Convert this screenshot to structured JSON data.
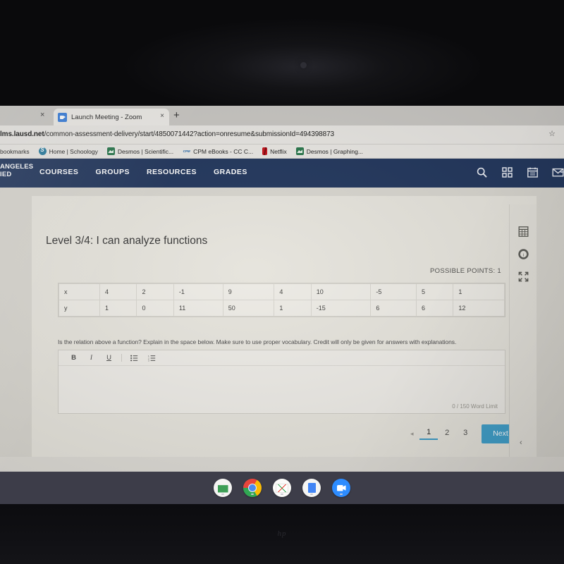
{
  "browser": {
    "tab": {
      "title": "Launch Meeting - Zoom",
      "favicon": "zoom-icon",
      "close_label": "×",
      "left_close_label": "×"
    },
    "new_tab_label": "+",
    "url": {
      "host": "lms.lausd.net",
      "path": "/common-assessment-delivery/start/4850071442?action=onresume&submissionId=494398873"
    },
    "star_label": "☆",
    "bookmarks": {
      "leading_label": "bookmarks",
      "items": [
        {
          "label": "Home | Schoology",
          "icon": "schoology-icon"
        },
        {
          "label": "Desmos | Scientific...",
          "icon": "desmos-icon"
        },
        {
          "label": "CPM eBooks - CC C...",
          "icon": "cpm-icon"
        },
        {
          "label": "Netflix",
          "icon": "netflix-icon"
        },
        {
          "label": "Desmos | Graphing...",
          "icon": "desmos-icon"
        }
      ]
    }
  },
  "navbar": {
    "logo_line1": "ANGELES",
    "logo_line2": "IED",
    "links": [
      "COURSES",
      "GROUPS",
      "RESOURCES",
      "GRADES"
    ],
    "icons": [
      "search-icon",
      "apps-grid-icon",
      "calendar-icon",
      "mail-icon"
    ],
    "background": "#1c3564"
  },
  "assessment": {
    "title": "Level 3/4: I can analyze functions",
    "counter": "1 of 3",
    "points": "POSSIBLE POINTS: 1",
    "table": {
      "rows": [
        {
          "header": "x",
          "values": [
            "4",
            "2",
            "-1",
            "9",
            "4",
            "10",
            "-5",
            "5",
            "1"
          ]
        },
        {
          "header": "y",
          "values": [
            "1",
            "0",
            "11",
            "50",
            "1",
            "-15",
            "6",
            "6",
            "12"
          ]
        }
      ]
    },
    "prompt": "Is the relation above a function? Explain in the space below. Make sure to use proper vocabulary. Credit will only be given for answers with explanations.",
    "editor": {
      "toolbar": [
        {
          "name": "bold",
          "label": "B"
        },
        {
          "name": "italic",
          "label": "I"
        },
        {
          "name": "underline",
          "label": "U"
        },
        {
          "name": "bulleted-list",
          "label": ""
        },
        {
          "name": "numbered-list",
          "label": ""
        }
      ],
      "value": "",
      "word_limit": "0 / 150 Word Limit"
    },
    "pagination": {
      "prev_label": "◂",
      "pages": [
        "1",
        "2",
        "3"
      ],
      "active_page": "1",
      "next_label": "Next ▸",
      "next_color": "#2fa3d8"
    },
    "rail": {
      "icons": [
        "calculator-icon",
        "info-icon",
        "fullscreen-icon"
      ],
      "collapse_label": "‹"
    }
  },
  "shelf": {
    "icons": [
      "classroom-icon",
      "chrome-icon",
      "gmail-icon",
      "docs-icon",
      "zoom-icon"
    ]
  },
  "device": {
    "brand": "hp"
  }
}
